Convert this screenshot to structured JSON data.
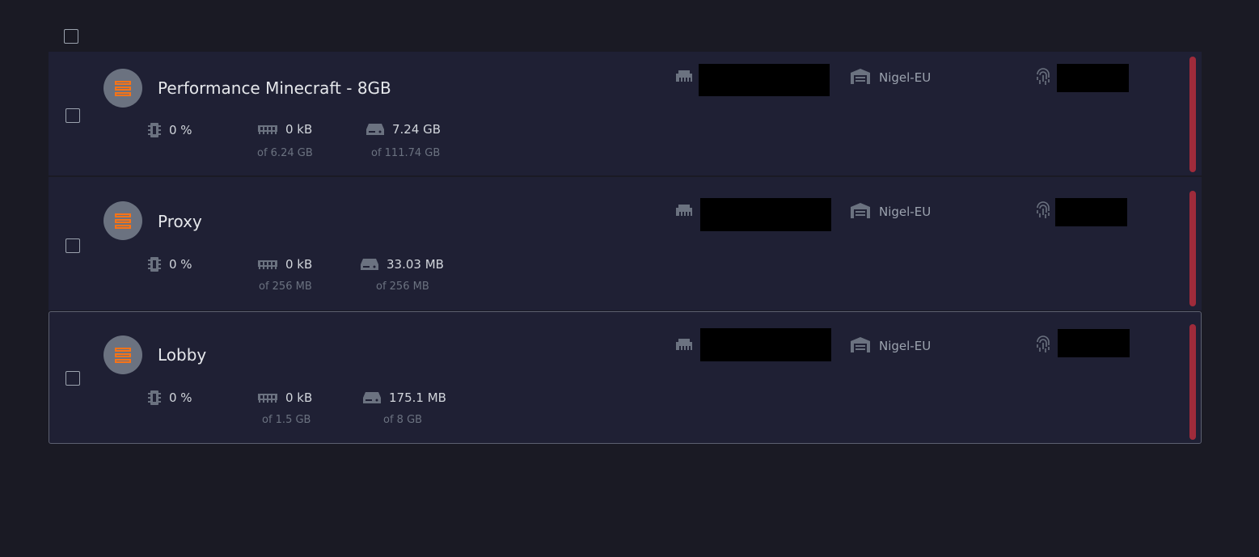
{
  "list": {
    "select_all_label": ""
  },
  "servers": [
    {
      "name": "Performance Minecraft - 8GB",
      "cpu": "0 %",
      "memory": "0 kB",
      "memory_limit": "of 6.24 GB",
      "disk": "7.24 GB",
      "disk_limit": "of 111.74 GB",
      "node": "Nigel-EU",
      "status": "offline"
    },
    {
      "name": "Proxy",
      "cpu": "0 %",
      "memory": "0 kB",
      "memory_limit": "of 256 MB",
      "disk": "33.03 MB",
      "disk_limit": "of 256 MB",
      "node": "Nigel-EU",
      "status": "offline"
    },
    {
      "name": "Lobby",
      "cpu": "0 %",
      "memory": "0 kB",
      "memory_limit": "of 1.5 GB",
      "disk": "175.1 MB",
      "disk_limit": "of 8 GB",
      "node": "Nigel-EU",
      "status": "offline"
    }
  ],
  "colors": {
    "background": "#1a1a24",
    "row_background": "#1f2034",
    "icon_circle": "#6b7280",
    "server_icon_accent": "#f97316",
    "status_offline": "#9f2b3b",
    "redaction": "#000000"
  },
  "icons": {
    "server": "server-stack-icon",
    "cpu": "cpu-chip-icon",
    "memory": "memory-ram-icon",
    "disk": "hard-drive-icon",
    "network": "ethernet-icon",
    "node": "warehouse-icon",
    "id": "fingerprint-icon"
  }
}
